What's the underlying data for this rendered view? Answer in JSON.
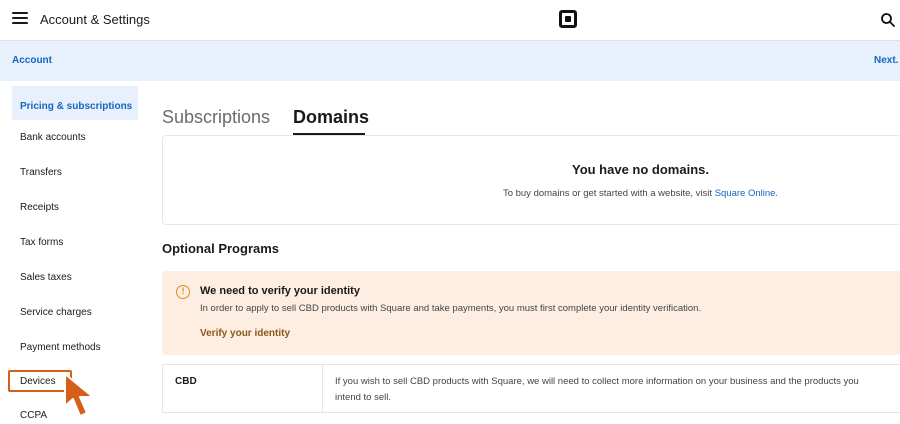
{
  "header": {
    "app_title": "Account & Settings",
    "menu_icon": "hamburger-menu-icon",
    "logo_icon": "square-logo-icon",
    "search_icon": "search-icon"
  },
  "breadcrumb": {
    "left": "Account",
    "right": "Next."
  },
  "sidebar": {
    "items": [
      {
        "label": "Pricing & subscriptions"
      },
      {
        "label": "Bank accounts"
      },
      {
        "label": "Transfers"
      },
      {
        "label": "Receipts"
      },
      {
        "label": "Tax forms"
      },
      {
        "label": "Sales taxes"
      },
      {
        "label": "Service charges"
      },
      {
        "label": "Payment methods"
      },
      {
        "label": "Devices"
      },
      {
        "label": "CCPA"
      }
    ]
  },
  "main": {
    "tabs": [
      {
        "label": "Subscriptions"
      },
      {
        "label": "Domains"
      }
    ],
    "domains": {
      "title": "You have no domains.",
      "text": "To buy domains or get started with a website, visit ",
      "link": "Square Online",
      "suffix": "."
    },
    "optional_title": "Optional Programs",
    "warning": {
      "title": "We need to verify your identity",
      "body": "In order to apply to sell CBD products with Square and take payments, you must first complete your identity verification.",
      "link": "Verify your identity"
    },
    "cbd": {
      "label": "CBD",
      "description": "If you wish to sell CBD products with Square, we will need to collect more information on your business and the products you intend to sell."
    }
  },
  "colors": {
    "accent": "#1565c0",
    "banner_bg": "#e8f0fc",
    "warning_bg": "#fdeee1",
    "highlight": "#d65f17"
  }
}
